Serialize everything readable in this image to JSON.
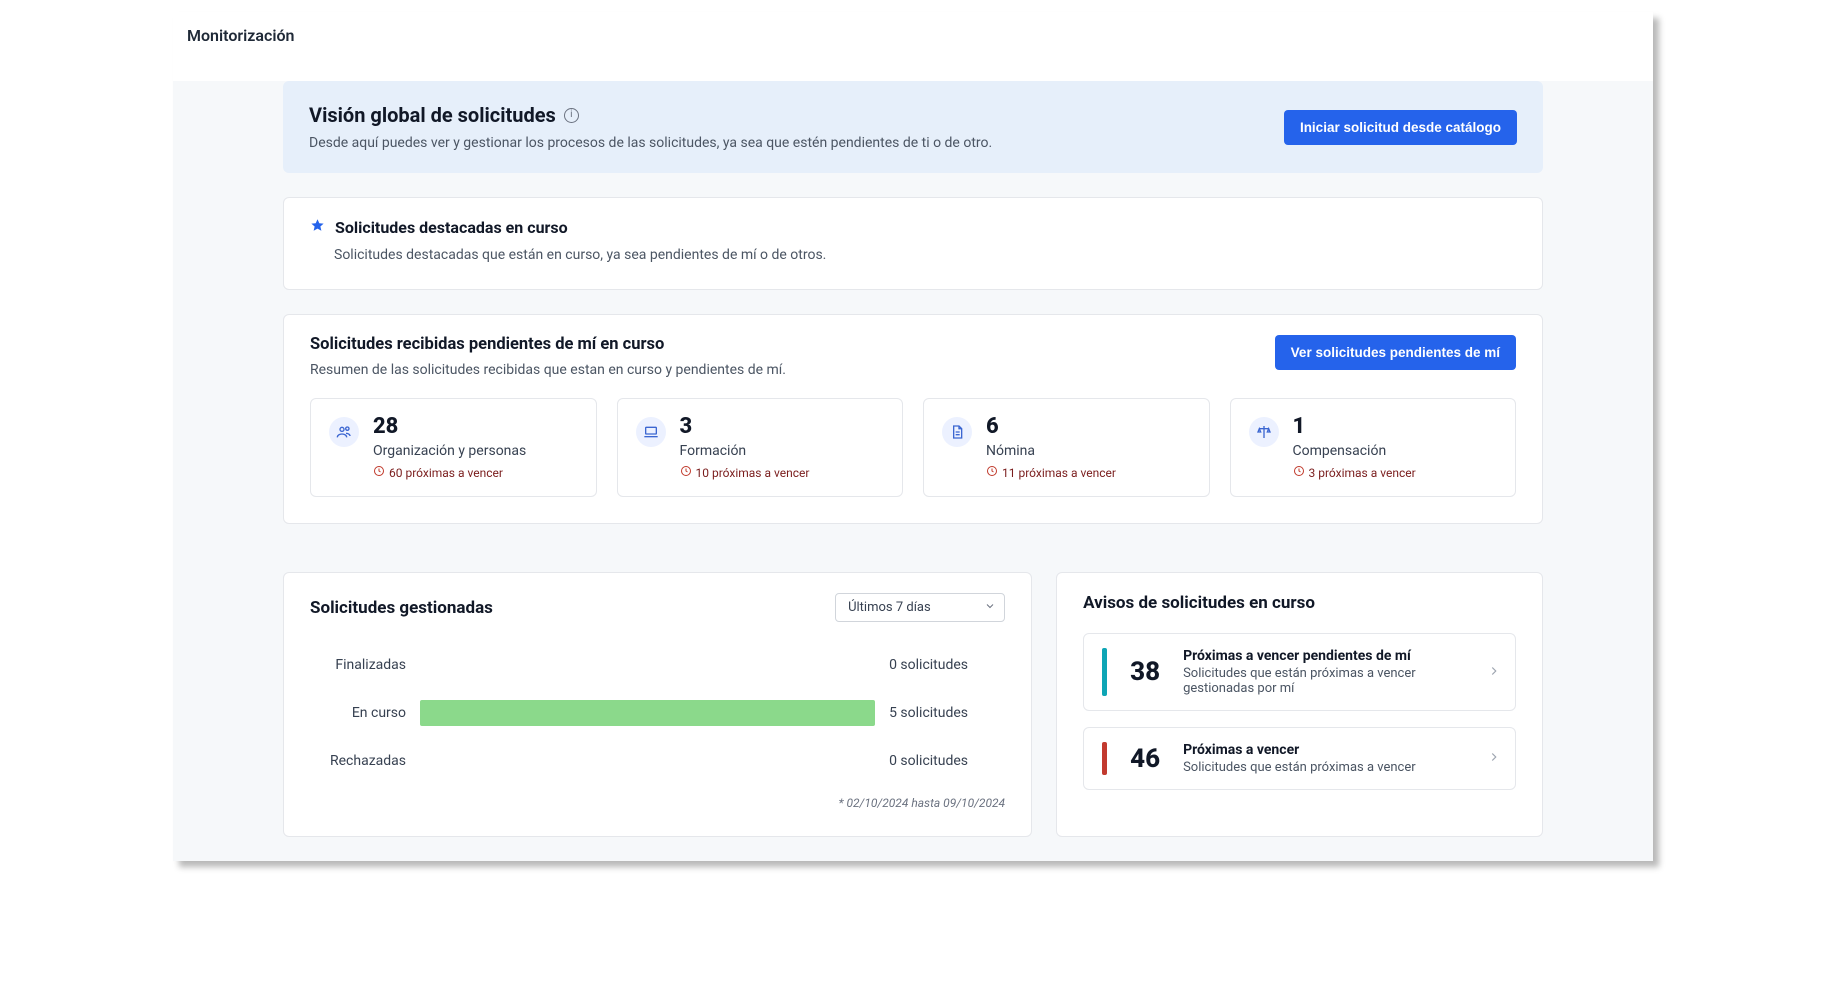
{
  "pageTitle": "Monitorización",
  "banner": {
    "title": "Visión global de solicitudes",
    "desc": "Desde aquí puedes ver y gestionar los procesos de las solicitudes, ya sea que estén pendientes de ti o de otro.",
    "cta": "Iniciar solicitud desde catálogo"
  },
  "featured": {
    "title": "Solicitudes destacadas en curso",
    "desc": "Solicitudes destacadas que están en curso, ya sea pendientes de mí o de otros."
  },
  "pending": {
    "title": "Solicitudes recibidas pendientes de mí en curso",
    "desc": "Resumen de las solicitudes recibidas que estan en curso y pendientes de mí.",
    "cta": "Ver solicitudes pendientes de mí",
    "tiles": [
      {
        "count": "28",
        "label": "Organización y personas",
        "warn": "60 próximas a vencer",
        "icon": "people"
      },
      {
        "count": "3",
        "label": "Formación",
        "warn": "10 próximas a vencer",
        "icon": "laptop"
      },
      {
        "count": "6",
        "label": "Nómina",
        "warn": "11 próximas a vencer",
        "icon": "doc"
      },
      {
        "count": "1",
        "label": "Compensación",
        "warn": "3 próximas a vencer",
        "icon": "balance"
      }
    ]
  },
  "managed": {
    "title": "Solicitudes gestionadas",
    "range": "Últimos 7 días",
    "rows": [
      {
        "label": "Finalizadas",
        "value": "0 solicitudes",
        "pct": 0
      },
      {
        "label": "En curso",
        "value": "5 solicitudes",
        "pct": 100
      },
      {
        "label": "Rechazadas",
        "value": "0 solicitudes",
        "pct": 0
      }
    ],
    "footnote": "* 02/10/2024 hasta 09/10/2024"
  },
  "chart_data": {
    "type": "bar",
    "title": "Solicitudes gestionadas",
    "categories": [
      "Finalizadas",
      "En curso",
      "Rechazadas"
    ],
    "values": [
      0,
      5,
      0
    ],
    "xlabel": "solicitudes",
    "ylabel": "",
    "ylim": [
      0,
      5
    ],
    "range": "Últimos 7 días",
    "footnote": "* 02/10/2024 hasta 09/10/2024"
  },
  "notices": {
    "title": "Avisos de solicitudes en curso",
    "items": [
      {
        "num": "38",
        "color": "blue",
        "title": "Próximas a vencer pendientes de mí",
        "desc": "Solicitudes que están próximas a vencer gestionadas por mí"
      },
      {
        "num": "46",
        "color": "red",
        "title": "Próximas a vencer",
        "desc": "Solicitudes que están próximas a vencer"
      }
    ]
  }
}
